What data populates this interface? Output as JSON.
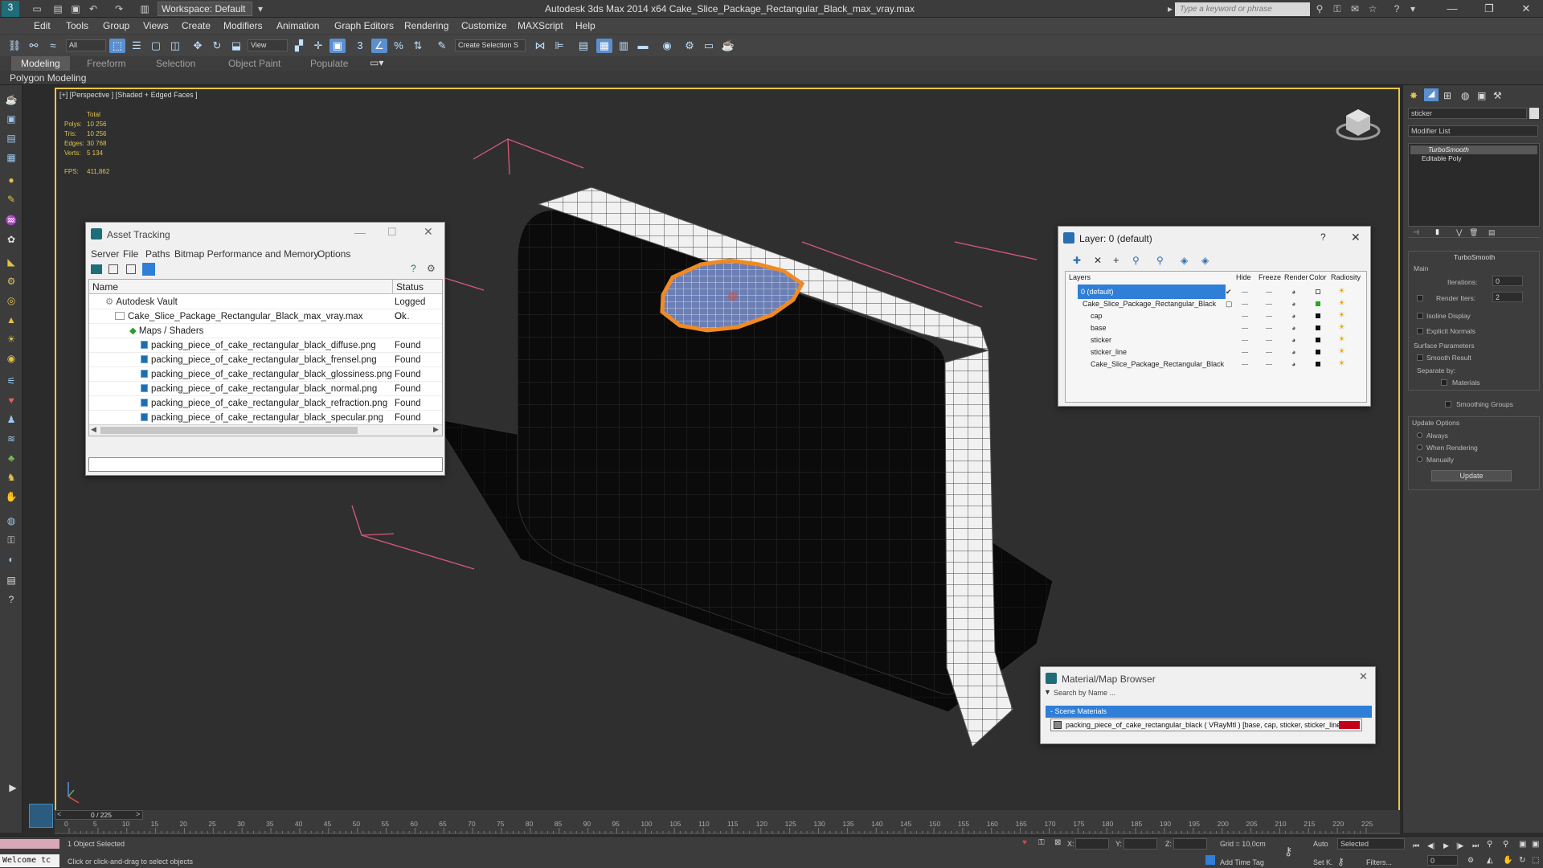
{
  "app": {
    "title": "Autodesk 3ds Max  2014 x64     Cake_Slice_Package_Rectangular_Black_max_vray.max",
    "workspace": "Workspace: Default",
    "search_placeholder": "Type a keyword or phrase"
  },
  "menu": [
    "Edit",
    "Tools",
    "Group",
    "Views",
    "Create",
    "Modifiers",
    "Animation",
    "Graph Editors",
    "Rendering",
    "Customize",
    "MAXScript",
    "Help"
  ],
  "toolbar": {
    "selection_filter": "All",
    "ref_coord": "View",
    "named_selection": "Create Selection S"
  },
  "ribbon": {
    "tabs": [
      "Modeling",
      "Freeform",
      "Selection",
      "Object Paint",
      "Populate"
    ],
    "active_tab": "Modeling",
    "sub_label": "Polygon Modeling"
  },
  "viewport": {
    "label": "[+] [Perspective ] [Shaded + Edged Faces ]",
    "stats": {
      "header": "Total",
      "rows": [
        {
          "label": "Polys:",
          "value": "10 256"
        },
        {
          "label": "Tris:",
          "value": "10 256"
        },
        {
          "label": "Edges:",
          "value": "30 768"
        },
        {
          "label": "Verts:",
          "value": "5 134"
        }
      ],
      "fps_label": "FPS:",
      "fps_value": "411,862"
    }
  },
  "asset_tracking": {
    "title": "Asset Tracking",
    "menu": [
      "Server",
      "File",
      "Paths",
      "Bitmap Performance and Memory",
      "Options"
    ],
    "columns": [
      "Name",
      "Status"
    ],
    "rows": [
      {
        "name": "Autodesk Vault",
        "status": "Logged O..."
      },
      {
        "name": "Cake_Slice_Package_Rectangular_Black_max_vray.max",
        "status": "Ok"
      },
      {
        "name": "Maps / Shaders",
        "status": ""
      },
      {
        "name": "packing_piece_of_cake_rectangular_black_diffuse.png",
        "status": "Found"
      },
      {
        "name": "packing_piece_of_cake_rectangular_black_frensel.png",
        "status": "Found"
      },
      {
        "name": "packing_piece_of_cake_rectangular_black_glossiness.png",
        "status": "Found"
      },
      {
        "name": "packing_piece_of_cake_rectangular_black_normal.png",
        "status": "Found"
      },
      {
        "name": "packing_piece_of_cake_rectangular_black_refraction.png",
        "status": "Found"
      },
      {
        "name": "packing_piece_of_cake_rectangular_black_specular.png",
        "status": "Found"
      }
    ]
  },
  "layer_window": {
    "title": "Layer: 0 (default)",
    "help": "?",
    "columns": [
      "Layers",
      "Hide",
      "Freeze",
      "Render",
      "Color",
      "Radiosity"
    ],
    "rows": [
      {
        "name": "0 (default)",
        "color": "#ffffff"
      },
      {
        "name": "Cake_Slice_Package_Rectangular_Black",
        "color": "#22aa22"
      },
      {
        "name": "cap",
        "color": "#111111"
      },
      {
        "name": "base",
        "color": "#111111"
      },
      {
        "name": "sticker",
        "color": "#111111"
      },
      {
        "name": "sticker_line",
        "color": "#111111"
      },
      {
        "name": "Cake_Slice_Package_Rectangular_Black",
        "color": "#111111"
      }
    ]
  },
  "material_browser": {
    "title": "Material/Map Browser",
    "search_placeholder": "Search by Name ...",
    "section": "- Scene Materials",
    "item": "packing_piece_of_cake_rectangular_black ( VRayMtl ) [base, cap, sticker, sticker_line]",
    "swatch_color": "#c4001a"
  },
  "command_panel": {
    "object_name": "sticker",
    "modifier_list": "Modifier List",
    "stack": [
      "TurboSmooth",
      "Editable Poly"
    ],
    "rollout": "TurboSmooth",
    "main_label": "Main",
    "iterations_label": "Iterations:",
    "iterations_value": "0",
    "render_iters_label": "Render Iters:",
    "render_iters_value": "2",
    "isoline": "Isoline Display",
    "explicit_normals": "Explicit Normals",
    "surface_params": "Surface Parameters",
    "smooth_result": "Smooth Result",
    "separate_by": "Separate by:",
    "materials": "Materials",
    "smoothing_groups": "Smoothing Groups",
    "update_options": "Update Options",
    "always": "Always",
    "when_rendering": "When Rendering",
    "manually": "Manually",
    "update_button": "Update"
  },
  "timeline": {
    "frame": "0 / 225",
    "ticks": [
      "0",
      "5",
      "10",
      "15",
      "20",
      "25",
      "30",
      "35",
      "40",
      "45",
      "50",
      "55",
      "60",
      "65",
      "70",
      "75",
      "80",
      "85",
      "90",
      "95",
      "100",
      "105",
      "110",
      "115",
      "120",
      "125",
      "130",
      "135",
      "140",
      "145",
      "150",
      "155",
      "160",
      "165",
      "170",
      "175",
      "180",
      "185",
      "190",
      "195",
      "200",
      "205",
      "210",
      "215",
      "220",
      "225"
    ]
  },
  "status": {
    "welcome": "Welcome tc",
    "selected": "1 Object Selected",
    "hint": "Click or click-and-drag to select objects",
    "x_label": "X:",
    "y_label": "Y:",
    "z_label": "Z:",
    "grid": "Grid = 10,0cm",
    "add_time_tag": "Add Time Tag",
    "auto": "Auto",
    "set_key": "Set K.",
    "selected_dropdown": "Selected",
    "filters": "Filters...",
    "frame_field": "0"
  }
}
